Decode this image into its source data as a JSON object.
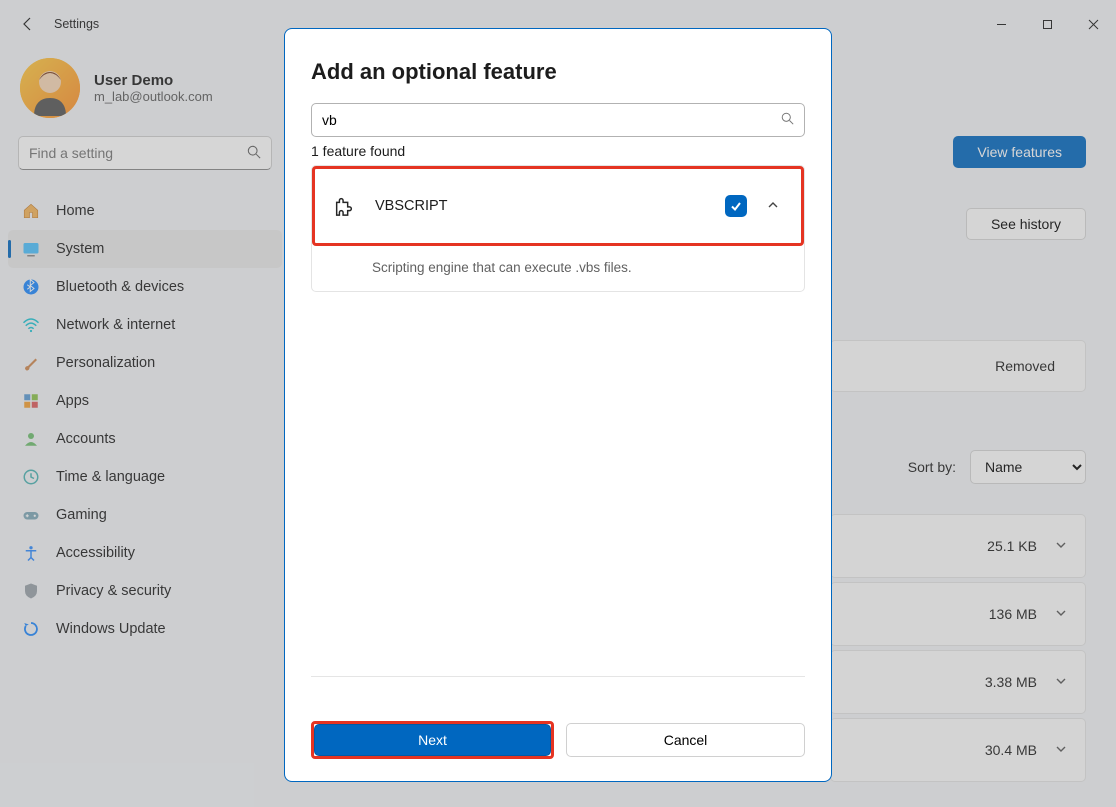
{
  "titlebar": {
    "title": "Settings"
  },
  "account": {
    "name": "User Demo",
    "email": "m_lab@outlook.com"
  },
  "search": {
    "placeholder": "Find a setting"
  },
  "nav": [
    {
      "label": "Home",
      "icon": "home"
    },
    {
      "label": "System",
      "icon": "system",
      "active": true
    },
    {
      "label": "Bluetooth & devices",
      "icon": "bluetooth"
    },
    {
      "label": "Network & internet",
      "icon": "wifi"
    },
    {
      "label": "Personalization",
      "icon": "brush"
    },
    {
      "label": "Apps",
      "icon": "apps"
    },
    {
      "label": "Accounts",
      "icon": "person"
    },
    {
      "label": "Time & language",
      "icon": "clock"
    },
    {
      "label": "Gaming",
      "icon": "gaming"
    },
    {
      "label": "Accessibility",
      "icon": "access"
    },
    {
      "label": "Privacy & security",
      "icon": "shield"
    },
    {
      "label": "Windows Update",
      "icon": "update"
    }
  ],
  "main": {
    "view_features_label": "View features",
    "see_history_label": "See history",
    "removed_text": "Removed",
    "sort_by_label": "Sort by:",
    "sort_value": "Name",
    "rows": [
      {
        "size": "25.1 KB"
      },
      {
        "size": "136 MB"
      },
      {
        "size": "3.38 MB"
      },
      {
        "size": "30.4 MB"
      }
    ]
  },
  "dialog": {
    "title": "Add an optional feature",
    "search_value": "vb",
    "found_text": "1 feature found",
    "feature": {
      "name": "VBSCRIPT",
      "description": "Scripting engine that can execute .vbs files.",
      "checked": true
    },
    "next_label": "Next",
    "cancel_label": "Cancel"
  }
}
